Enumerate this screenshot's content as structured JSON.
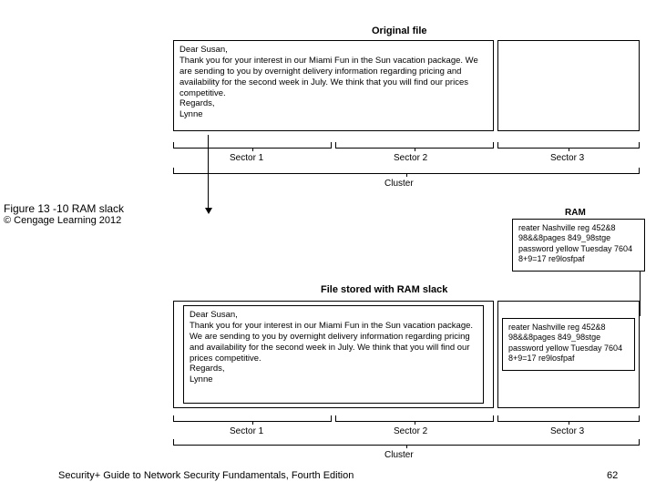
{
  "original": {
    "title": "Original file",
    "letter": "Dear Susan,\n   Thank you for your interest in our Miami Fun in the Sun vacation package. We are sending to you by overnight delivery information regarding pricing and availability for the second week in July. We think that you will find our prices competitive.\nRegards,\nLynne"
  },
  "ram": {
    "title": "RAM",
    "text": "reater Nashville reg 452&8 98&&8pages 849_98stge password yellow Tuesday 7604 8+9=17 re9losfpaf"
  },
  "slack": {
    "title": "File stored with RAM slack",
    "letter": "Dear Susan,\n          Thank you for your interest in our Miami Fun in the Sun vacation package. We are sending to you by overnight delivery information regarding pricing and availability for the second week in July. We think that you will find our prices competitive.\nRegards,\nLynne",
    "ram_text": "reater Nashville reg 452&8 98&&8pages 849_98stge password yellow Tuesday 7604 8+9=17 re9losfpaf"
  },
  "sectors": {
    "s1": "Sector 1",
    "s2": "Sector 2",
    "s3": "Sector 3",
    "cluster": "Cluster"
  },
  "caption": {
    "figure": "Figure 13 -10 RAM slack",
    "copyright": "© Cengage Learning 2012"
  },
  "footer": {
    "text": "Security+ Guide to Network Security Fundamentals, Fourth Edition",
    "page": "62"
  }
}
